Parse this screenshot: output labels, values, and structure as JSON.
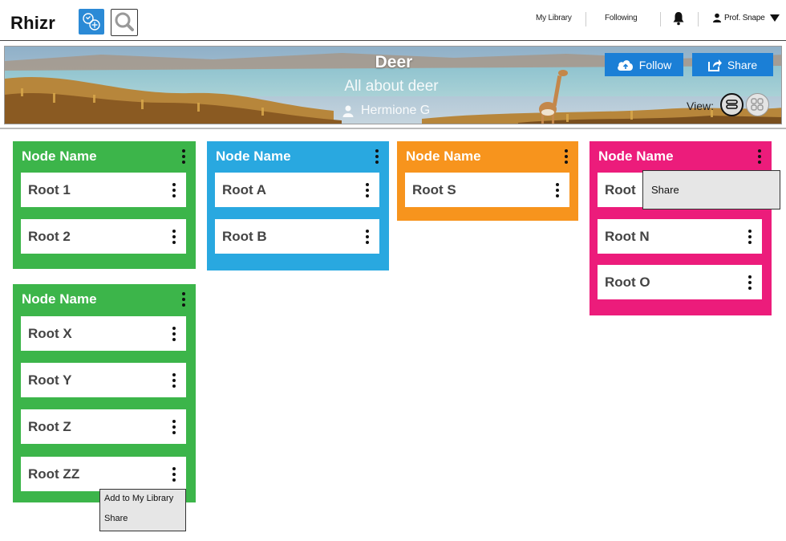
{
  "app": {
    "name": "Rhizr"
  },
  "nav": {
    "my_library": "My Library",
    "following": "Following",
    "user_name": "Prof. Snape"
  },
  "banner": {
    "title": "Deer",
    "subtitle": "All about deer",
    "author": "Hermione G",
    "follow_label": "Follow",
    "share_label": "Share",
    "view_label": "View:"
  },
  "colors": {
    "green": "#3cb54a",
    "blue": "#29a8e0",
    "orange": "#f7941d",
    "pink": "#ec1c7b",
    "button_blue": "#1b7fd6"
  },
  "cards": [
    {
      "title": "Node Name",
      "color": "green",
      "items": [
        "Root 1",
        "Root 2"
      ]
    },
    {
      "title": "Node Name",
      "color": "blue",
      "items": [
        "Root A",
        "Root B"
      ]
    },
    {
      "title": "Node Name",
      "color": "orange",
      "items": [
        "Root S"
      ]
    },
    {
      "title": "Node Name",
      "color": "pink",
      "items": [
        "Root",
        "Root N",
        "Root O"
      ]
    },
    {
      "title": "Node Name",
      "color": "green",
      "items": [
        "Root X",
        "Root Y",
        "Root Z",
        "Root ZZ"
      ]
    }
  ],
  "menus": {
    "pink_card_menu": [
      "Share"
    ],
    "item_menu": [
      "Add to My Library",
      "Share"
    ]
  }
}
